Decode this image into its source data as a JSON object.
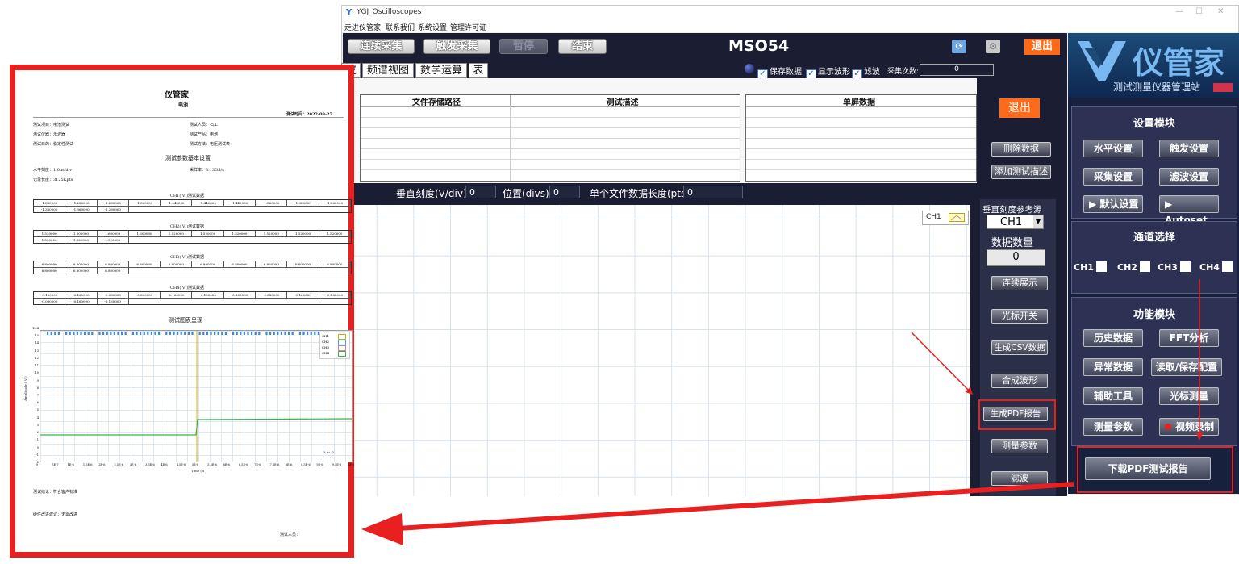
{
  "window": {
    "title": "YGJ_Oscilloscopes",
    "menu": [
      "走进仪管家",
      "联系我们",
      "系统设置",
      "管理许可证"
    ]
  },
  "toolbar": {
    "continuous": "连续采集",
    "trigger": "触发采集",
    "pause": "暂停",
    "end": "结束",
    "model": "MSO54",
    "exit": "退出"
  },
  "tabs": [
    "波形",
    "频谱视图",
    "数学运算",
    "表"
  ],
  "options": {
    "save": "保存数据",
    "show": "显示波形",
    "filter": "滤波",
    "count_label": "采集次数:",
    "count_value": "0"
  },
  "file_table": {
    "col_path": "文件存储路径",
    "col_desc": "测试描述",
    "single_title": "单屏数据"
  },
  "right_top": {
    "exit": "退出",
    "delete": "删除数据",
    "add_desc": "添加测试描述"
  },
  "params": {
    "vdiv_label": "垂直刻度(V/div):",
    "vdiv_value": "0",
    "pos_label": "位置(divs):",
    "pos_value": "0",
    "len_label": "单个文件数据长度(pts):",
    "len_value": "0"
  },
  "plot": {
    "legend": "CH1"
  },
  "side": {
    "ref_label": "垂直刻度参考源",
    "ref_value": "CH1",
    "count_label": "数据数量",
    "count_value": "0",
    "buttons": [
      "连续展示",
      "光标开关",
      "生成CSV数据",
      "合成波形",
      "生成PDF报告",
      "测量参数",
      "滤波"
    ]
  },
  "brand": {
    "name": "仪管家",
    "subtitle": "测试测量仪器管理站",
    "settings_title": "设置模块",
    "settings": [
      "水平设置",
      "触发设置",
      "采集设置",
      "滤波设置",
      "▶  默认设置",
      "▶  Autoset"
    ],
    "channel_title": "通道选择",
    "channels": [
      "CH1",
      "CH2",
      "CH3",
      "CH4"
    ],
    "function_title": "功能模块",
    "functions": [
      "历史数据",
      "FFT分析",
      "异常数据",
      "读取/保存配置",
      "辅助工具",
      "光标测量",
      "测量参数",
      "视频录制"
    ],
    "download": "下载PDF测试报告"
  },
  "report": {
    "title": "仪管家",
    "subtitle": "电池",
    "test_time": "测试时间：2022-09-27",
    "project": "测试项目：电池测试",
    "tester": "测试人员：石工",
    "instrument": "测试仪器：示波器",
    "product": "测试产品：电池",
    "purpose": "测试目的：稳定性测试",
    "method": "测试方法：电压测试表",
    "section_settings": "测试参数基本设置",
    "horizontal": "水平刻度：1.0us/div",
    "sample_rate": "采样率：3.13GS/s",
    "record_length": "记录长度：3125Kpts",
    "ch1_title": "CH1( V )测试数据",
    "ch1_row1": [
      "-1.360000",
      "-1.280000",
      "-1.280000",
      "-1.360000",
      "-1.440000",
      "-1.440000",
      "-1.440000",
      "-1.360000",
      "-1.360000",
      "-1.360000"
    ],
    "ch1_row2": [
      "-1.360000",
      "-1.360000",
      "-1.280000"
    ],
    "ch2_title": "CH2( V )测试数据",
    "ch2_row1": [
      "1.520000",
      "1.600000",
      "1.600000",
      "1.600000",
      "1.520000",
      "1.520000",
      "1.520000",
      "1.520000",
      "1.520000",
      "1.520000"
    ],
    "ch2_row2": [
      "1.520000",
      "1.520000",
      "1.520000"
    ],
    "ch3_title": "CH3( V )测试数据",
    "ch3_row1": [
      "6.800000",
      "6.800000",
      "6.800000",
      "6.800000",
      "6.800000",
      "6.800000",
      "6.800000",
      "6.800000",
      "6.800000",
      "6.800000"
    ],
    "ch3_row2": [
      "6.800000",
      "6.800000",
      "6.800000"
    ],
    "ch4_title": "CH4( V )测试数据",
    "ch4_row1": [
      "-0.160000",
      "-0.160000",
      "-0.080000",
      "-0.080000",
      "-0.160000",
      "-0.160000",
      "-0.160000",
      "-0.080000",
      "-0.160000",
      "-0.160000"
    ],
    "ch4_row2": [
      "-0.080000",
      "-0.160000",
      "-0.160000"
    ],
    "chart_title": "测试图表呈现",
    "chart_legend": [
      "CH1",
      "CH2",
      "CH3",
      "CH4"
    ],
    "y_axis_label": "Amplitude ( V )",
    "x_axis_label": "Time ( s )",
    "y_ticks": [
      "16.4",
      "15",
      "14",
      "13",
      "12",
      "11",
      "10",
      "9",
      "8",
      "7",
      "6",
      "5",
      "4",
      "3",
      "2",
      "1",
      "0",
      "-1",
      "-2"
    ],
    "x_ticks": [
      "0",
      "5E-7",
      "1E-6",
      "1.5E-6",
      "2E-6",
      "2.5E-6",
      "3E-6",
      "3.5E-6",
      "4E-6",
      "4.5E-6",
      "5E-6",
      "5.5E-6",
      "6E-6",
      "6.5E-6",
      "7E-6",
      "7.5E-6",
      "8E-6",
      "8.5E-6",
      "9E-6",
      "9.5E-6",
      "1E-5"
    ],
    "conclusion": "测试结论：符合客户标准",
    "suggestion": "硬件改进建议：无需改进",
    "signer": "测试人员："
  }
}
